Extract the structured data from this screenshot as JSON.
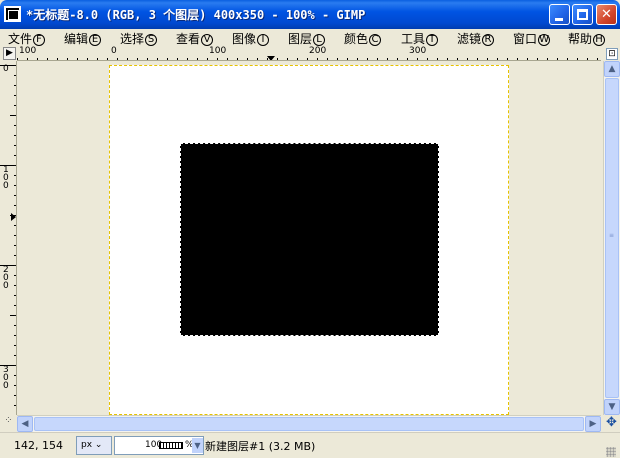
{
  "window": {
    "title": "*无标题-8.0 (RGB, 3 个图层) 400x350 - 100% - GIMP",
    "icon": "gimp-image-icon",
    "minimize_label": "",
    "maximize_label": "",
    "close_label": "✕"
  },
  "menu": [
    {
      "label": "文件",
      "key": "F"
    },
    {
      "label": "编辑",
      "key": "E"
    },
    {
      "label": "选择",
      "key": "S"
    },
    {
      "label": "查看",
      "key": "V"
    },
    {
      "label": "图像",
      "key": "I"
    },
    {
      "label": "图层",
      "key": "L"
    },
    {
      "label": "颜色",
      "key": "C"
    },
    {
      "label": "工具",
      "key": "T"
    },
    {
      "label": "滤镜",
      "key": "R"
    },
    {
      "label": "窗口",
      "key": "W"
    },
    {
      "label": "帮助",
      "key": "H"
    }
  ],
  "rulers": {
    "horizontal": [
      "100",
      "0",
      "100",
      "200",
      "300"
    ],
    "vertical": [
      "0",
      "100",
      "200",
      "300"
    ]
  },
  "canvas": {
    "image_size": "400x350",
    "background_color": "#ffffff",
    "layer_color": "#000000",
    "boundary_color": "#e6c200"
  },
  "status": {
    "coords": "142, 154",
    "unit": "px",
    "zoom": "100",
    "zoom_suffix": "%",
    "message": "新建图层#1 (3.2 MB)"
  }
}
